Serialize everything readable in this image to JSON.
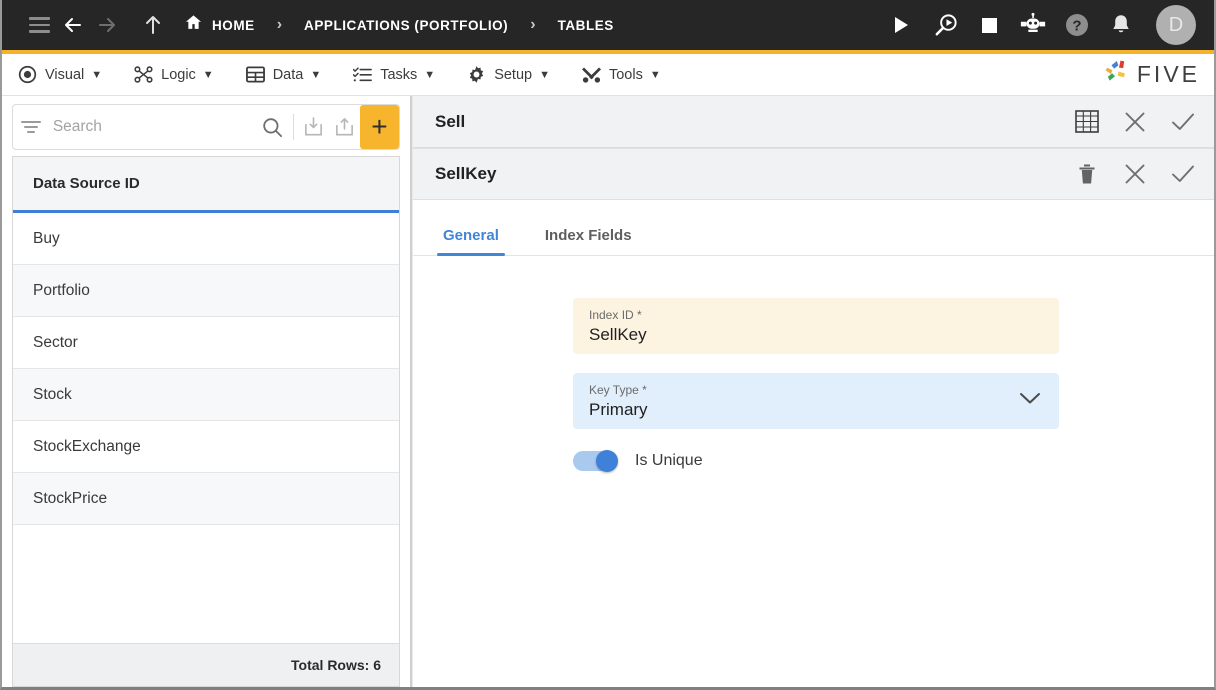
{
  "topbar": {
    "nav": {
      "menu_icon": "hamburger-icon",
      "back_icon": "arrow-back-icon",
      "forward_icon": "arrow-forward-icon",
      "up_icon": "arrow-up-icon"
    },
    "breadcrumbs": [
      {
        "label": "HOME",
        "icon": "home-icon"
      },
      {
        "label": "APPLICATIONS (PORTFOLIO)",
        "icon": ""
      },
      {
        "label": "TABLES",
        "icon": ""
      }
    ],
    "separator": "›",
    "actions": [
      {
        "name": "run-button",
        "icon": "play-icon"
      },
      {
        "name": "debug-button",
        "icon": "magnifier-play-icon"
      },
      {
        "name": "stop-button",
        "icon": "stop-icon"
      },
      {
        "name": "assistant-button",
        "icon": "robot-icon"
      },
      {
        "name": "help-button",
        "icon": "question-circle-icon"
      },
      {
        "name": "notifications-button",
        "icon": "bell-icon"
      }
    ],
    "avatar_initial": "D",
    "accent_color": "#f5b32b"
  },
  "menubar": {
    "items": [
      {
        "label": "Visual",
        "icon": "eye-icon",
        "caret": "▼"
      },
      {
        "label": "Logic",
        "icon": "logic-nodes-icon",
        "caret": "▼"
      },
      {
        "label": "Data",
        "icon": "table-grid-icon",
        "caret": "▼"
      },
      {
        "label": "Tasks",
        "icon": "checklist-icon",
        "caret": "▼"
      },
      {
        "label": "Setup",
        "icon": "gear-icon",
        "caret": "▼"
      },
      {
        "label": "Tools",
        "icon": "tools-icon",
        "caret": "▼"
      }
    ],
    "brand": {
      "text": "FIVE",
      "icon": "five-pinwheel-logo"
    }
  },
  "sidebar": {
    "search": {
      "placeholder": "Search",
      "value": "",
      "filter_icon": "filter-icon",
      "search_icon": "search-icon",
      "import_icon": "import-download-icon",
      "export_icon": "export-upload-icon",
      "add_label": "+"
    },
    "grid": {
      "column_header": "Data Source ID",
      "rows": [
        "Buy",
        "Portfolio",
        "Sector",
        "Stock",
        "StockExchange",
        "StockPrice"
      ],
      "footer": "Total Rows: 6"
    }
  },
  "main": {
    "outer_panel": {
      "title": "Sell",
      "actions": [
        {
          "name": "table-view-button",
          "icon": "table-grid-icon"
        },
        {
          "name": "close-button",
          "icon": "close-x-icon"
        },
        {
          "name": "save-button",
          "icon": "check-icon"
        }
      ]
    },
    "inner_panel": {
      "title": "SellKey",
      "actions": [
        {
          "name": "delete-button",
          "icon": "trash-icon"
        },
        {
          "name": "close-button",
          "icon": "close-x-icon"
        },
        {
          "name": "save-button",
          "icon": "check-icon"
        }
      ]
    },
    "tabs": [
      {
        "label": "General",
        "active": true
      },
      {
        "label": "Index Fields",
        "active": false
      }
    ],
    "form": {
      "index_id": {
        "label": "Index ID *",
        "value": "SellKey"
      },
      "key_type": {
        "label": "Key Type *",
        "value": "Primary",
        "chevron_icon": "chevron-down-icon"
      },
      "is_unique": {
        "label": "Is Unique",
        "checked": true
      }
    },
    "annotation": {
      "type": "red-arrow",
      "points_to": "inner-panel-save-button",
      "color": "#e8201a"
    }
  }
}
